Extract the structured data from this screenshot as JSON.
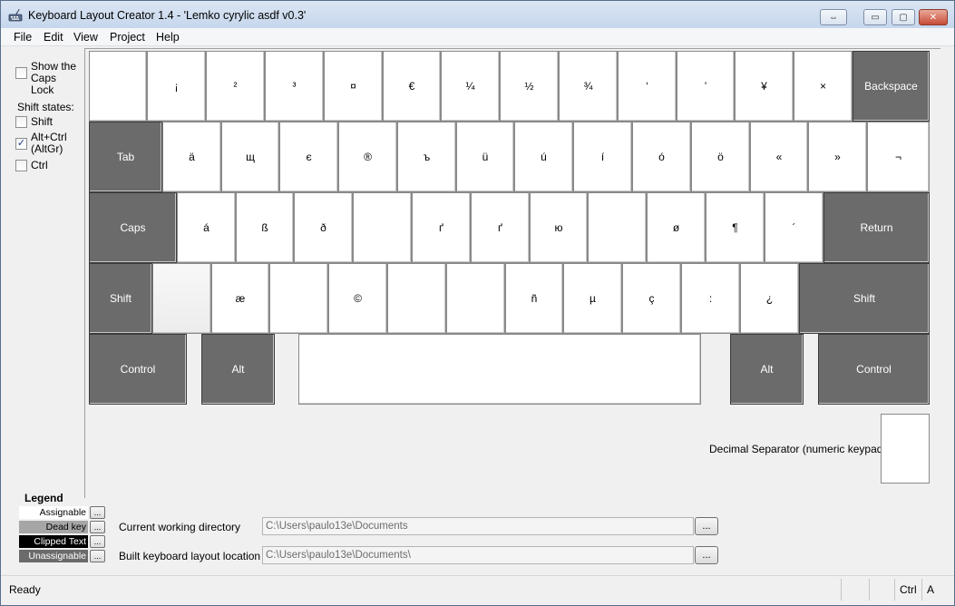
{
  "window": {
    "title": "Keyboard Layout Creator 1.4 - 'Lemko cyrylic asdf v0.3'",
    "controls": [
      "⇔",
      "▭",
      "▢",
      "✕"
    ]
  },
  "menu": [
    "File",
    "Edit",
    "View",
    "Project",
    "Help"
  ],
  "options": {
    "caps_lock_label": "Show the Caps Lock",
    "shift_states_label": "Shift states:",
    "shift_label": "Shift",
    "altgr_label": "Alt+Ctrl (AltGr)",
    "ctrl_label": "Ctrl",
    "caps_lock_checked": false,
    "shift_checked": false,
    "altgr_checked": true,
    "ctrl_checked": false
  },
  "keyboard": {
    "rows": [
      [
        "",
        "¡",
        "²",
        "³",
        "¤",
        "€",
        "¼",
        "½",
        "¾",
        "‘",
        "’",
        "¥",
        "×",
        "Backspace"
      ],
      [
        "Tab",
        "ä",
        "щ",
        "є",
        "®",
        "ъ",
        "ü",
        "ú",
        "í",
        "ó",
        "ö",
        "«",
        "»",
        "¬"
      ],
      [
        "Caps",
        "á",
        "ß",
        "ð",
        "",
        "ґ",
        "ґ",
        "ю",
        "",
        "ø",
        "¶",
        "´",
        "Return"
      ],
      [
        "Shift",
        "",
        "æ",
        "",
        "©",
        "",
        "",
        "ñ",
        "µ",
        "ç",
        ":",
        "¿",
        "Shift"
      ],
      [
        "Control",
        "Alt",
        "",
        "Alt",
        "Control"
      ]
    ],
    "decimal_label": "Decimal Separator (numeric keypad)"
  },
  "legend": {
    "title": "Legend",
    "items": [
      {
        "label": "Assignable",
        "bg": "#ffffff",
        "fg": "#000000"
      },
      {
        "label": "Dead key",
        "bg": "#a6a6a6",
        "fg": "#000000"
      },
      {
        "label": "Clipped Text",
        "bg": "#000000",
        "fg": "#ffffff"
      },
      {
        "label": "Unassignable",
        "bg": "#6b6b6b",
        "fg": "#ffffff"
      }
    ],
    "button_label": "..."
  },
  "paths": {
    "cwd_label": "Current working directory",
    "cwd_value": "C:\\Users\\paulo13e\\Documents",
    "build_label": "Built keyboard layout location",
    "build_value": "C:\\Users\\paulo13e\\Documents\\",
    "browse_label": "..."
  },
  "status": {
    "text": "Ready",
    "ctrl": "Ctrl",
    "alt": "A"
  }
}
